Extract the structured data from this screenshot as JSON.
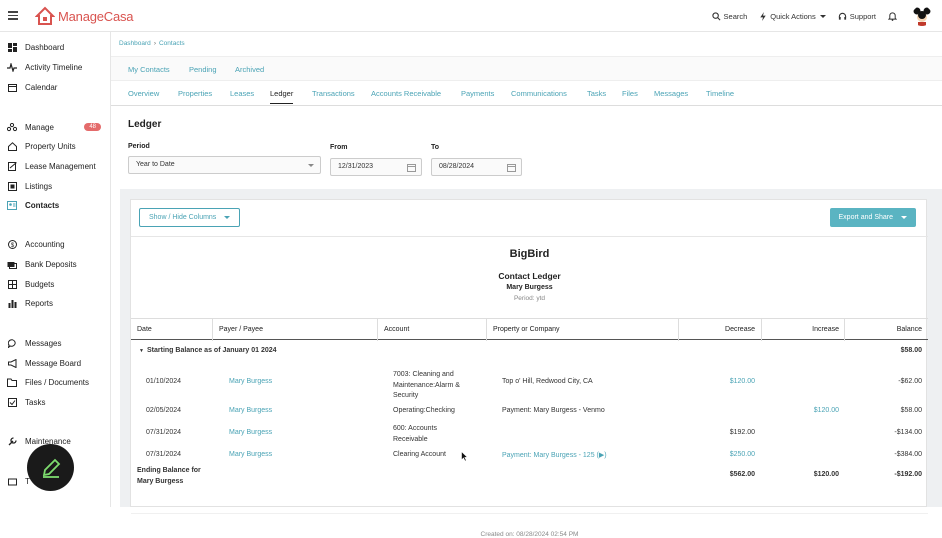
{
  "app": {
    "name_part1": "Manage",
    "name_part2": "Casa",
    "brand_color": "#d9534f",
    "accent_color": "#4aa3b5"
  },
  "topbar": {
    "search": "Search",
    "quick_actions": "Quick Actions",
    "support": "Support"
  },
  "sidebar": {
    "items": [
      {
        "label": "Dashboard",
        "icon": "dashboard-icon"
      },
      {
        "label": "Activity Timeline",
        "icon": "activity-icon"
      },
      {
        "label": "Calendar",
        "icon": "calendar-icon"
      },
      {
        "label": "Manage",
        "icon": "manage-icon",
        "badge": "48"
      },
      {
        "label": "Property Units",
        "icon": "home-icon"
      },
      {
        "label": "Lease Management",
        "icon": "lease-icon"
      },
      {
        "label": "Listings",
        "icon": "listings-icon"
      },
      {
        "label": "Contacts",
        "icon": "contacts-icon"
      },
      {
        "label": "Accounting",
        "icon": "dollar-icon"
      },
      {
        "label": "Bank Deposits",
        "icon": "bank-icon"
      },
      {
        "label": "Budgets",
        "icon": "budget-icon"
      },
      {
        "label": "Reports",
        "icon": "reports-icon"
      },
      {
        "label": "Messages",
        "icon": "messages-icon"
      },
      {
        "label": "Message Board",
        "icon": "megaphone-icon"
      },
      {
        "label": "Files / Documents",
        "icon": "folder-icon"
      },
      {
        "label": "Tasks",
        "icon": "tasks-icon"
      },
      {
        "label": "Maintenance",
        "icon": "wrench-icon"
      },
      {
        "label": "T",
        "icon": "tenant-icon"
      }
    ]
  },
  "breadcrumb": {
    "root": "Dashboard",
    "current": "Contacts"
  },
  "subtabs": [
    "My Contacts",
    "Pending",
    "Archived"
  ],
  "tabs": [
    "Overview",
    "Properties",
    "Leases",
    "Ledger",
    "Transactions",
    "Accounts Receivable",
    "Payments",
    "Communications",
    "Tasks",
    "Files",
    "Messages",
    "Timeline"
  ],
  "ledger": {
    "title": "Ledger",
    "period_label": "Period",
    "period_value": "Year to Date",
    "from_label": "From",
    "from_value": "12/31/2023",
    "to_label": "To",
    "to_value": "08/28/2024",
    "show_hide": "Show / Hide Columns",
    "export": "Export and Share",
    "company": "BigBird",
    "report_title": "Contact Ledger",
    "contact": "Mary Burgess",
    "period_text": "Period: ytd",
    "columns": [
      "Date",
      "Payer / Payee",
      "Account",
      "Property or Company",
      "Decrease",
      "Increase",
      "Balance"
    ],
    "starting_label": "Starting Balance as of January 01 2024",
    "starting_balance": "$58.00",
    "rows": [
      {
        "date": "01/10/2024",
        "payee": "Mary Burgess",
        "account": "7003: Cleaning and Maintenance:Alarm & Security",
        "property": "Top o' Hill, Redwood City, CA",
        "decrease": "$120.00",
        "increase": "",
        "balance": "-$62.00"
      },
      {
        "date": "02/05/2024",
        "payee": "Mary Burgess",
        "account": "Operating:Checking",
        "property": "Payment: Mary Burgess - Venmo",
        "decrease": "",
        "increase": "$120.00",
        "balance": "$58.00"
      },
      {
        "date": "07/31/2024",
        "payee": "Mary Burgess",
        "account": "600: Accounts Receivable",
        "property": "",
        "decrease": "$192.00",
        "increase": "",
        "balance": "-$134.00"
      },
      {
        "date": "07/31/2024",
        "payee": "Mary Burgess",
        "account": "Clearing Account",
        "property": "Payment: Mary Burgess - 125 (▶)",
        "decrease": "$250.00",
        "increase": "",
        "balance": "-$384.00"
      }
    ],
    "ending_label": "Ending Balance for Mary Burgess",
    "ending_decrease": "$562.00",
    "ending_increase": "$120.00",
    "ending_balance": "-$192.00",
    "created_on": "Created on: 08/28/2024 02:54 PM"
  }
}
